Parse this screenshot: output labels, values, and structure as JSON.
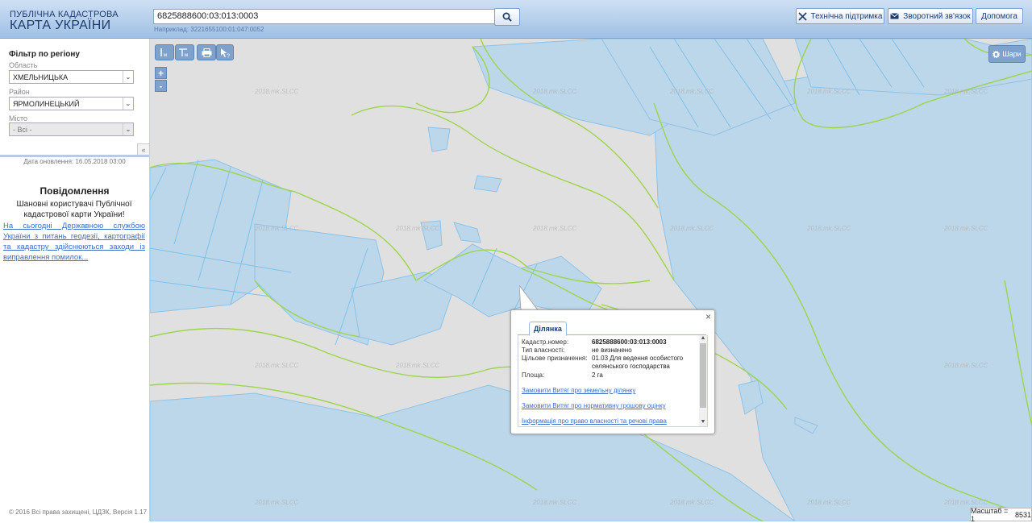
{
  "app": {
    "title_line1": "ПУБЛІЧНА КАДАСТРОВА",
    "title_line2": "КАРТА УКРАЇНИ"
  },
  "search": {
    "value": "6825888600:03:013:0003",
    "hint": "Наприклад: 3221655100:01:047:0052"
  },
  "header_buttons": {
    "support": "Технічна підтримка",
    "feedback": "Зворотний зв'язок",
    "help": "Допомога"
  },
  "filter": {
    "title": "Фільтр по регіону",
    "region_label": "Область",
    "region_value": "ХМЕЛЬНИЦЬКА",
    "district_label": "Район",
    "district_value": "ЯРМОЛИНЕЦЬКИЙ",
    "city_label": "Місто",
    "city_value": "- Всі -"
  },
  "updated": "Дата оновлення: 16.05.2018 03:00",
  "notices": {
    "title": "Повідомлення",
    "body": "Шановні користувачі Публічної кадастрової карти України!",
    "link": "На сьогодні Державною службою України з питань геодезії, картографії та кадастру здійснюються заходи із виправлення помилок..."
  },
  "copyright": "© 2016 Всі права захищені, ЦДЗК, Версія 1.17",
  "map": {
    "layers_label": "Шари",
    "watermark": "2018.mk.SLCC",
    "scale_label": "Масштаб = 1",
    "scale_value": "8531"
  },
  "toolbar": {
    "zoom_in": "+",
    "zoom_out": "-"
  },
  "popup": {
    "tab": "Ділянка",
    "fields": [
      {
        "label": "Кадастр.номер:",
        "value": "6825888600:03:013:0003"
      },
      {
        "label": "Тип власності:",
        "value": "не визначено"
      },
      {
        "label": "Цільове призначення:",
        "value": "01.03 Для ведення особистого селянського господарства"
      },
      {
        "label": "Площа:",
        "value": "2 га"
      }
    ],
    "links": [
      "Замовити Витяг про земельну ділянку",
      "Замовити Витяг про нормативну грошову оцінку",
      "Інформація про право власності та речові права"
    ]
  },
  "colors": {
    "parcel_fill": "#bcd6ea",
    "boundary": "#9dd54a",
    "parcel_edge": "#6fb8e6",
    "map_bg": "#e0e0e0"
  }
}
